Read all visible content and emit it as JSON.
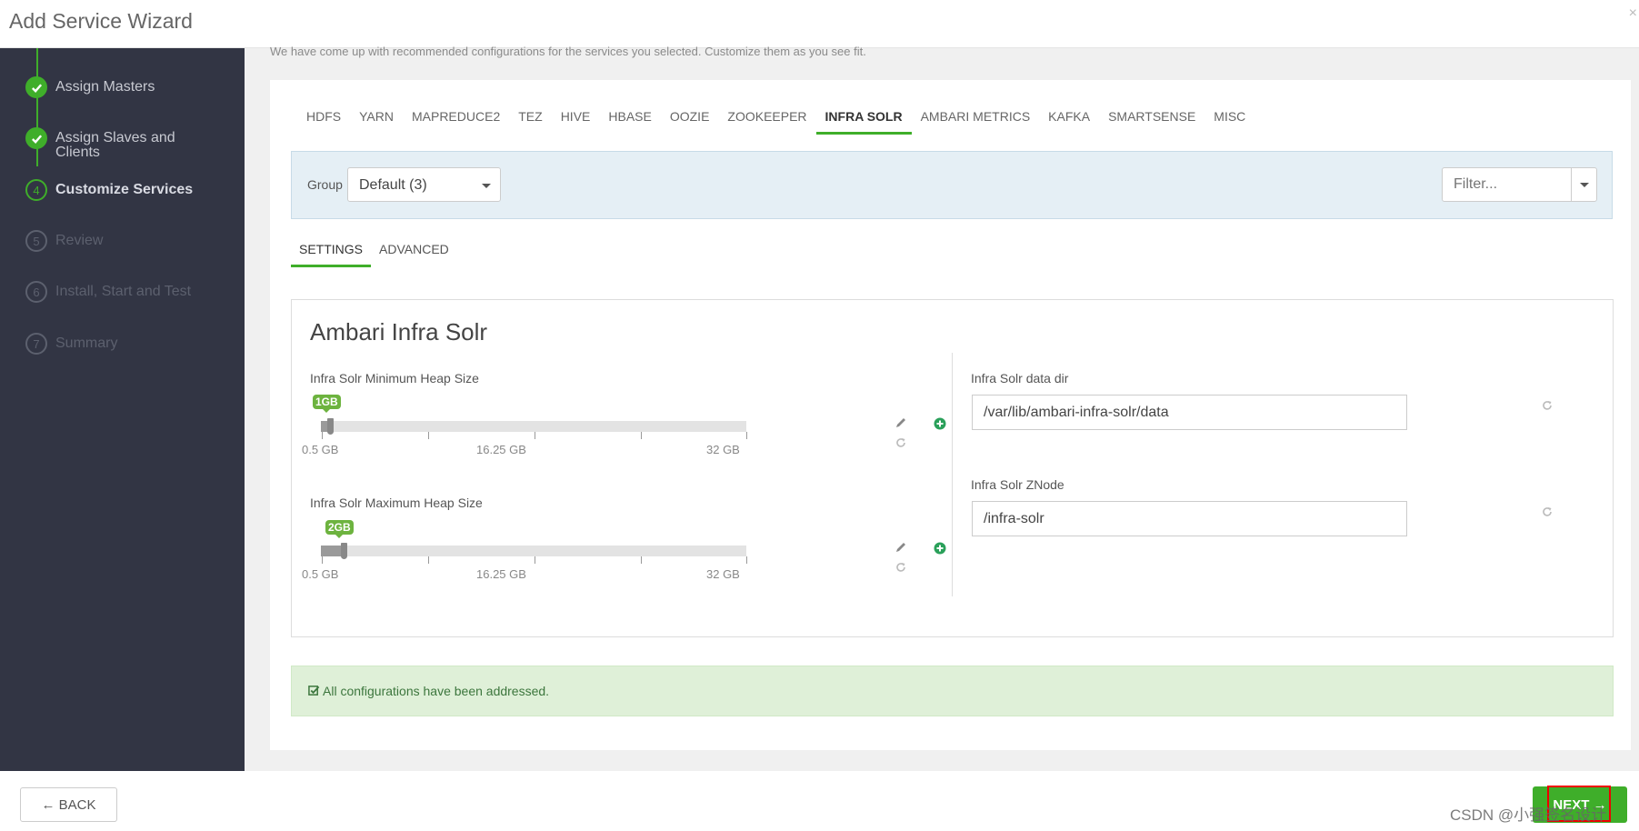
{
  "header": {
    "title": "Add Service Wizard",
    "close_label": "×"
  },
  "sidebar": {
    "steps": [
      {
        "num": "",
        "label": "Assign Masters",
        "state": "done"
      },
      {
        "num": "",
        "label": "Assign Slaves and Clients",
        "state": "done"
      },
      {
        "num": "4",
        "label": "Customize Services",
        "state": "current"
      },
      {
        "num": "5",
        "label": "Review",
        "state": "future"
      },
      {
        "num": "6",
        "label": "Install, Start and Test",
        "state": "future"
      },
      {
        "num": "7",
        "label": "Summary",
        "state": "future"
      }
    ]
  },
  "main": {
    "intro": "We have come up with recommended configurations for the services you selected. Customize them as you see fit.",
    "service_tabs": [
      "HDFS",
      "YARN",
      "MAPREDUCE2",
      "TEZ",
      "HIVE",
      "HBASE",
      "OOZIE",
      "ZOOKEEPER",
      "INFRA SOLR",
      "AMBARI METRICS",
      "KAFKA",
      "SMARTSENSE",
      "MISC"
    ],
    "active_service_tab": "INFRA SOLR",
    "group_label": "Group",
    "group_value": "Default (3)",
    "filter_placeholder": "Filter...",
    "sub_tabs": [
      "SETTINGS",
      "ADVANCED"
    ],
    "section_title": "Ambari Infra Solr",
    "sliders": [
      {
        "label": "Infra Solr Minimum Heap Size",
        "value_label": "1GB",
        "value_gb": 1,
        "min": 0.5,
        "max": 32,
        "tick_labels": [
          "0.5 GB",
          "16.25 GB",
          "32 GB"
        ]
      },
      {
        "label": "Infra Solr Maximum Heap Size",
        "value_label": "2GB",
        "value_gb": 2,
        "min": 0.5,
        "max": 32,
        "tick_labels": [
          "0.5 GB",
          "16.25 GB",
          "32 GB"
        ]
      }
    ],
    "text_fields": [
      {
        "label": "Infra Solr data dir",
        "value": "/var/lib/ambari-infra-solr/data"
      },
      {
        "label": "Infra Solr ZNode",
        "value": "/infra-solr"
      }
    ],
    "alert_text": "All configurations have been addressed."
  },
  "footer": {
    "back_label": "← BACK",
    "next_label": "NEXT →",
    "watermark": "CSDN @小强签名设计"
  },
  "colors": {
    "accent": "#3fae2a",
    "sidebar_bg": "#323544",
    "alert_bg": "#dff0d8",
    "highlight": "#e00000"
  }
}
